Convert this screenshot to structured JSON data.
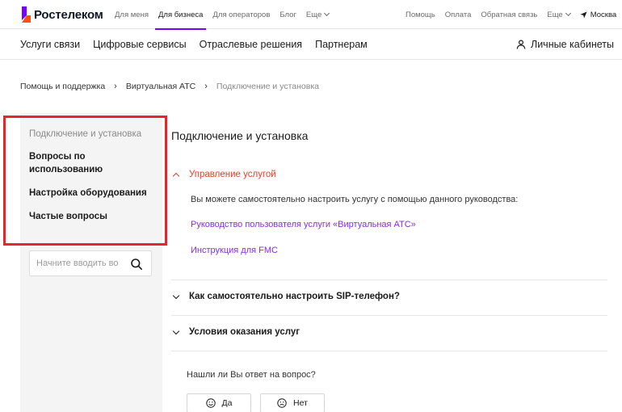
{
  "brand": {
    "name": "Ростелеком"
  },
  "topnav": {
    "left": [
      {
        "label": "Для меня"
      },
      {
        "label": "Для бизнеса"
      },
      {
        "label": "Для операторов"
      },
      {
        "label": "Блог"
      },
      {
        "label": "Еще"
      }
    ],
    "right": [
      {
        "label": "Помощь"
      },
      {
        "label": "Оплата"
      },
      {
        "label": "Обратная связь"
      },
      {
        "label": "Еще"
      }
    ],
    "city": "Москва"
  },
  "secnav": {
    "items": [
      "Услуги связи",
      "Цифровые сервисы",
      "Отраслевые решения",
      "Партнерам"
    ],
    "cabinets": "Личные кабинеты"
  },
  "breadcrumb": [
    "Помощь и поддержка",
    "Виртуальная АТС",
    "Подключение и установка"
  ],
  "sidebar": {
    "items": [
      {
        "label": "Подключение и установка"
      },
      {
        "label": "Вопросы по использованию"
      },
      {
        "label": "Настройка оборудования"
      },
      {
        "label": "Частые вопросы"
      }
    ],
    "search_placeholder": "Начните вводить во"
  },
  "main": {
    "title": "Подключение и установка",
    "accordion": [
      {
        "title": "Управление услугой",
        "text": "Вы можете самостоятельно настроить услугу с помощью данного руководства:",
        "links": [
          "Руководство пользователя услуги «Виртуальная АТС»",
          "Инструкция для FMC"
        ]
      },
      {
        "title": "Как самостоятельно настроить SIP-телефон?"
      },
      {
        "title": "Условия оказания услуг"
      }
    ],
    "feedback": {
      "question": "Нашли ли Вы ответ на вопрос?",
      "yes": "Да",
      "no": "Нет"
    }
  },
  "colors": {
    "accent": "#7700ff",
    "link": "#8a2be2",
    "open_section": "#e4412a",
    "highlight_box": "#e5262b"
  }
}
